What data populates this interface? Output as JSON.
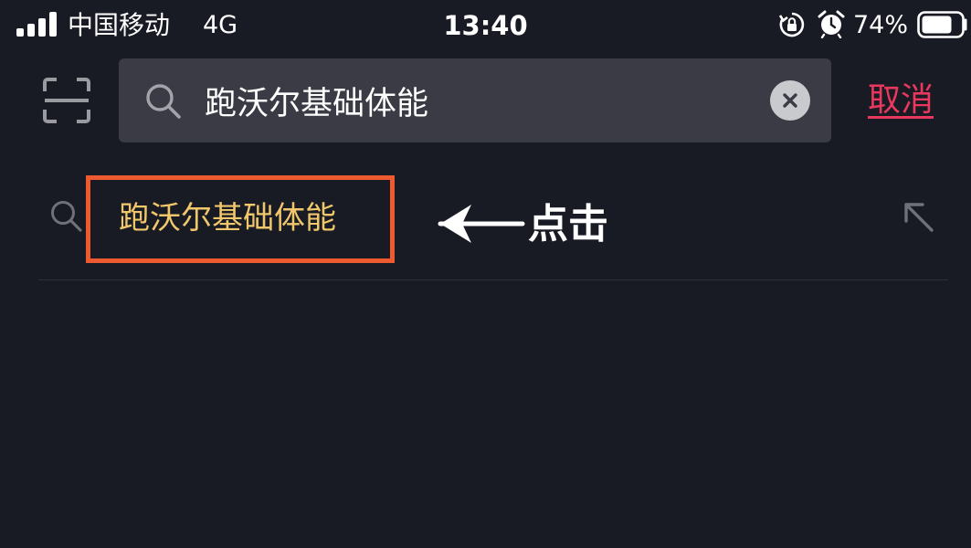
{
  "status_bar": {
    "carrier": "中国移动",
    "network": "4G",
    "time": "13:40",
    "battery_percent": "74%",
    "icons": {
      "signal": "signal-bars-icon",
      "rotation_lock": "rotation-lock-icon",
      "alarm": "alarm-clock-icon",
      "battery": "battery-icon"
    }
  },
  "search": {
    "value": "跑沃尔基础体能",
    "cancel_label": "取消",
    "icons": {
      "scan": "scan-icon",
      "search": "search-icon",
      "clear": "clear-icon"
    }
  },
  "suggestions": [
    {
      "text": "跑沃尔基础体能",
      "icons": {
        "leading": "search-icon",
        "trailing": "fill-arrow-icon"
      }
    }
  ],
  "annotation": {
    "label": "点击"
  },
  "colors": {
    "background": "#181a24",
    "search_box": "#3a3b44",
    "cancel": "#e8385e",
    "suggestion_text": "#f0c76a",
    "highlight_border": "#ee5a30"
  }
}
